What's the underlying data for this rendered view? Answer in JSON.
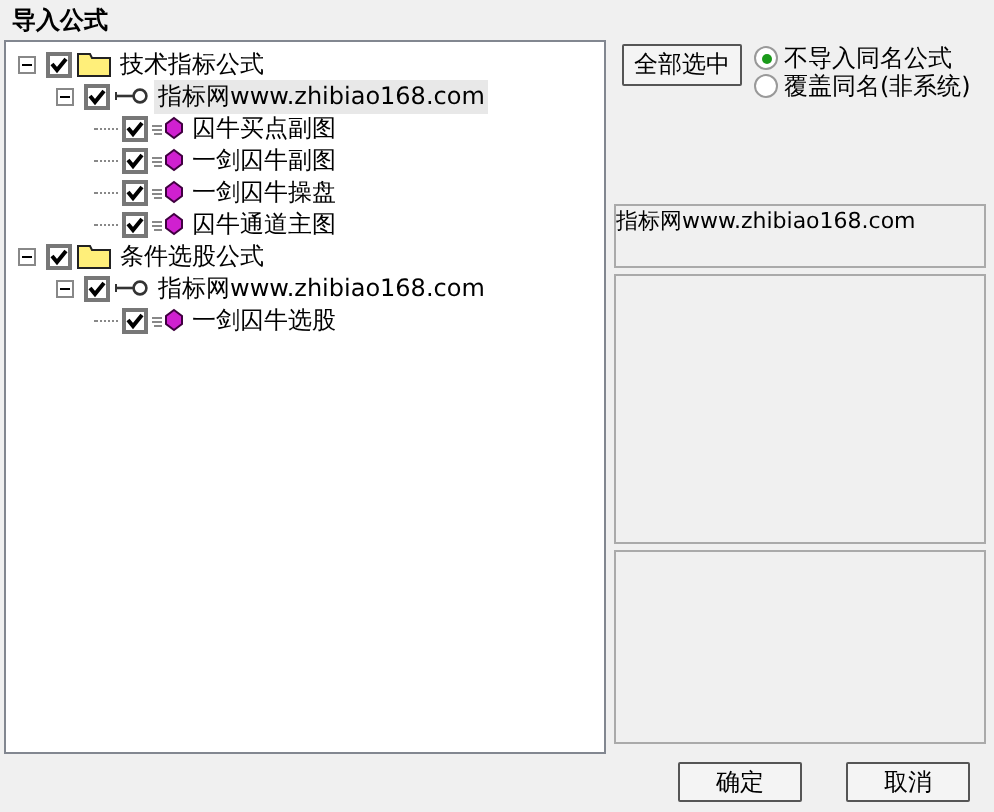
{
  "window": {
    "title": "导入公式"
  },
  "tree": [
    {
      "kind": "folder",
      "label": "技术指标公式",
      "checked": true,
      "expanded": true,
      "children": [
        {
          "kind": "site",
          "label": "指标网www.zhibiao168.com",
          "checked": true,
          "expanded": true,
          "selected": true,
          "children": [
            {
              "kind": "formula",
              "label": "囚牛买点副图",
              "checked": true
            },
            {
              "kind": "formula",
              "label": "一剑囚牛副图",
              "checked": true
            },
            {
              "kind": "formula",
              "label": "一剑囚牛操盘",
              "checked": true
            },
            {
              "kind": "formula",
              "label": "囚牛通道主图",
              "checked": true
            }
          ]
        }
      ]
    },
    {
      "kind": "folder",
      "label": "条件选股公式",
      "checked": true,
      "expanded": true,
      "children": [
        {
          "kind": "site",
          "label": "指标网www.zhibiao168.com",
          "checked": true,
          "expanded": true,
          "selected": false,
          "children": [
            {
              "kind": "formula",
              "label": "一剑囚牛选股",
              "checked": true
            }
          ]
        }
      ]
    }
  ],
  "select_all_button": "全部选中",
  "options": [
    {
      "label": "不导入同名公式",
      "selected": true
    },
    {
      "label": "覆盖同名(非系统)",
      "selected": false
    }
  ],
  "info_box": "指标网www.zhibiao168.com",
  "buttons": [
    "确定",
    "取消"
  ]
}
